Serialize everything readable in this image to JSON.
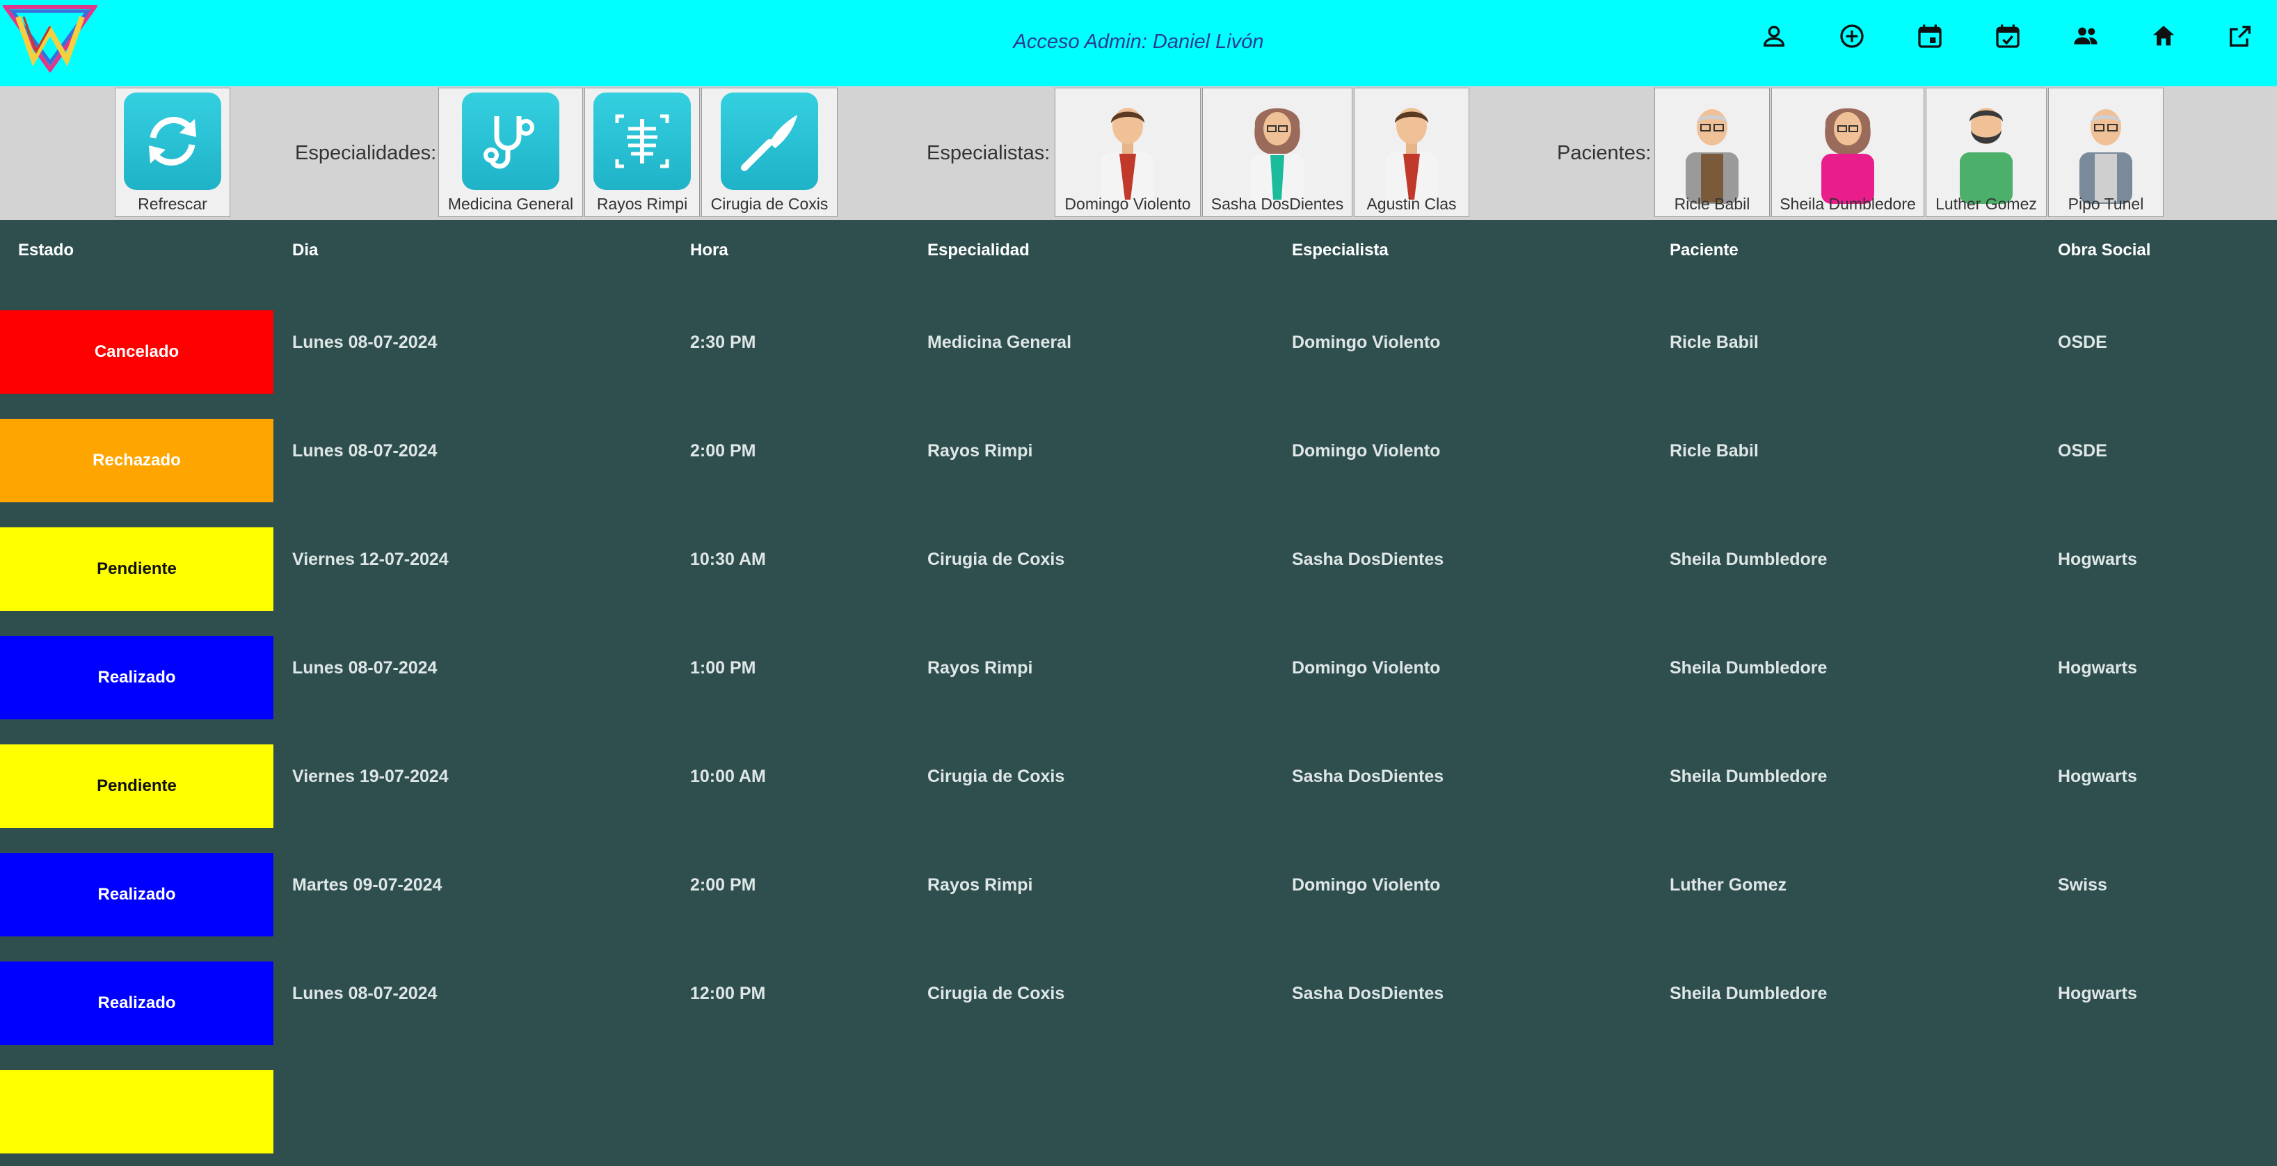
{
  "header": {
    "admin_label": "Acceso Admin: Daniel Livón",
    "icons": [
      "user-icon",
      "add-circle-icon",
      "calendar-icon",
      "calendar-check-icon",
      "group-icon",
      "home-icon",
      "external-link-icon"
    ]
  },
  "filters": {
    "refresh_label": "Refrescar",
    "especialidades_label": "Especialidades:",
    "especialistas_label": "Especialistas:",
    "pacientes_label": "Pacientes:",
    "especialidades": [
      "Medicina General",
      "Rayos Rimpi",
      "Cirugia de Coxis"
    ],
    "especialistas": [
      "Domingo Violento",
      "Sasha DosDientes",
      "Agustin Clas"
    ],
    "pacientes": [
      "Ricle Babil",
      "Sheila Dumbledore",
      "Luther Gomez",
      "Pipo Tunel"
    ]
  },
  "table": {
    "headers": [
      "Estado",
      "Dia",
      "Hora",
      "Especialidad",
      "Especialista",
      "Paciente",
      "Obra Social"
    ],
    "rows": [
      {
        "estado": "Cancelado",
        "color": "#ff0000",
        "text_color": "#ffffff",
        "dia": "Lunes 08-07-2024",
        "hora": "2:30 PM",
        "especialidad": "Medicina General",
        "especialista": "Domingo Violento",
        "paciente": "Ricle Babil",
        "obra": "OSDE"
      },
      {
        "estado": "Rechazado",
        "color": "#ffa500",
        "text_color": "#ffffff",
        "dia": "Lunes 08-07-2024",
        "hora": "2:00 PM",
        "especialidad": "Rayos Rimpi",
        "especialista": "Domingo Violento",
        "paciente": "Ricle Babil",
        "obra": "OSDE"
      },
      {
        "estado": "Pendiente",
        "color": "#ffff00",
        "text_color": "#111111",
        "dia": "Viernes 12-07-2024",
        "hora": "10:30 AM",
        "especialidad": "Cirugia de Coxis",
        "especialista": "Sasha DosDientes",
        "paciente": "Sheila Dumbledore",
        "obra": "Hogwarts"
      },
      {
        "estado": "Realizado",
        "color": "#0000ff",
        "text_color": "#ffffff",
        "dia": "Lunes 08-07-2024",
        "hora": "1:00 PM",
        "especialidad": "Rayos Rimpi",
        "especialista": "Domingo Violento",
        "paciente": "Sheila Dumbledore",
        "obra": "Hogwarts"
      },
      {
        "estado": "Pendiente",
        "color": "#ffff00",
        "text_color": "#111111",
        "dia": "Viernes 19-07-2024",
        "hora": "10:00 AM",
        "especialidad": "Cirugia de Coxis",
        "especialista": "Sasha DosDientes",
        "paciente": "Sheila Dumbledore",
        "obra": "Hogwarts"
      },
      {
        "estado": "Realizado",
        "color": "#0000ff",
        "text_color": "#ffffff",
        "dia": "Martes 09-07-2024",
        "hora": "2:00 PM",
        "especialidad": "Rayos Rimpi",
        "especialista": "Domingo Violento",
        "paciente": "Luther Gomez",
        "obra": "Swiss"
      },
      {
        "estado": "Realizado",
        "color": "#0000ff",
        "text_color": "#ffffff",
        "dia": "Lunes 08-07-2024",
        "hora": "12:00 PM",
        "especialidad": "Cirugia de Coxis",
        "especialista": "Sasha DosDientes",
        "paciente": "Sheila Dumbledore",
        "obra": "Hogwarts"
      },
      {
        "estado": "",
        "color": "#ffff00",
        "text_color": "#111111",
        "dia": "",
        "hora": "",
        "especialidad": "",
        "especialista": "",
        "paciente": "",
        "obra": ""
      }
    ]
  }
}
